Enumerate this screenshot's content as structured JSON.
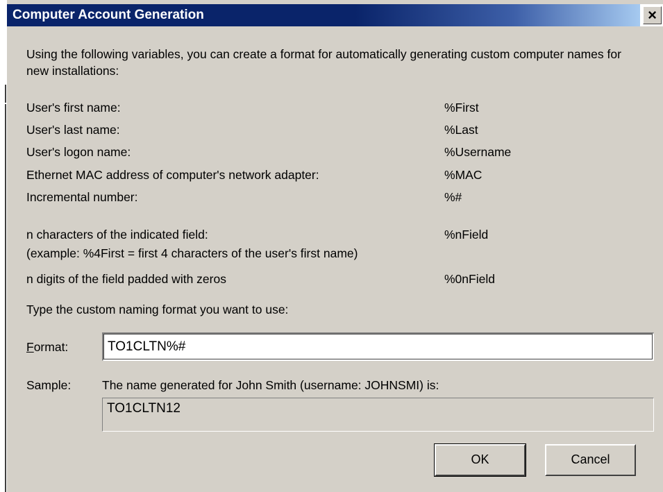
{
  "window": {
    "title": "Computer Account Generation",
    "close_glyph": "×"
  },
  "intro_text": "Using the following variables, you can create a format for automatically generating custom computer names for new installations:",
  "variables": [
    {
      "label": "User's first name:",
      "code": "%First"
    },
    {
      "label": "User's last name:",
      "code": "%Last"
    },
    {
      "label": "User's logon name:",
      "code": "%Username"
    },
    {
      "label": "Ethernet MAC address of computer's network adapter:",
      "code": "%MAC"
    },
    {
      "label": "Incremental number:",
      "code": "%#"
    },
    {
      "label": "n characters of the indicated field:",
      "code": "%nField"
    },
    {
      "label": "(example: %4First = first 4 characters of the user's first name)",
      "code": ""
    },
    {
      "label": "n digits of the field padded with zeros",
      "code": "%0nField"
    }
  ],
  "prompt_text": "Type the custom naming format you want to use:",
  "format": {
    "label": "Format:",
    "value": "TO1CLTN%#"
  },
  "sample": {
    "label": "Sample:",
    "description": "The name generated for John Smith (username: JOHNSMI) is:",
    "value": "TO1CLTN12"
  },
  "buttons": {
    "ok_label": "OK",
    "cancel_label": "Cancel"
  }
}
